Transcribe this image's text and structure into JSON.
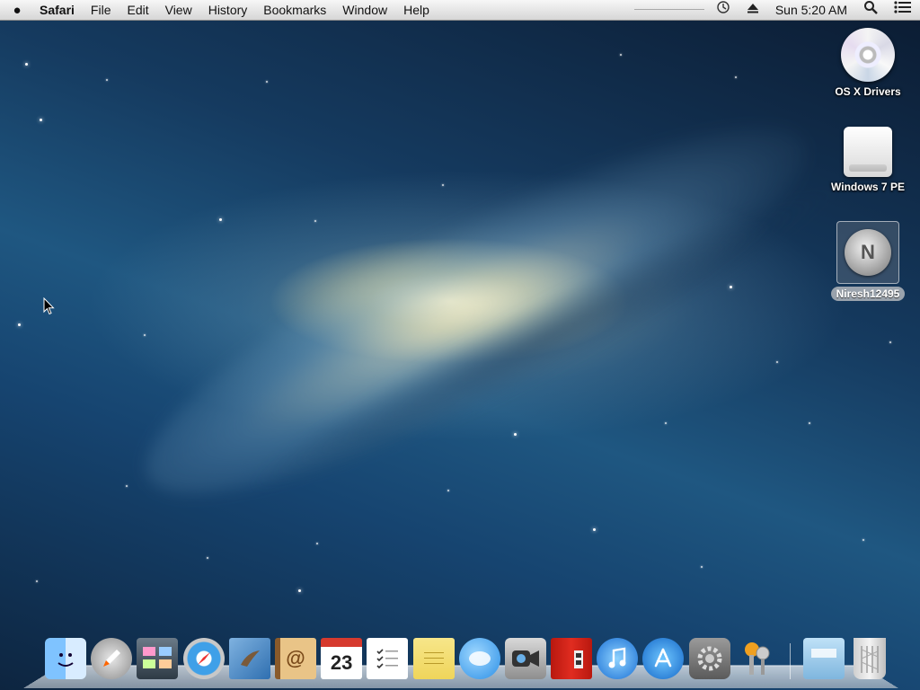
{
  "menubar": {
    "app_name": "Safari",
    "menus": [
      "File",
      "Edit",
      "View",
      "History",
      "Bookmarks",
      "Window",
      "Help"
    ],
    "clock": "Sun 5:20 AM"
  },
  "desktop": {
    "icons": [
      {
        "label": "OS X Drivers"
      },
      {
        "label": "Windows 7 PE"
      },
      {
        "label": "Niresh12495",
        "volume_glyph": "N"
      }
    ]
  },
  "dock": {
    "calendar_day": "23",
    "items": [
      "finder-icon",
      "launchpad-icon",
      "mission-control-icon",
      "safari-icon",
      "mail-icon",
      "contacts-icon",
      "calendar-icon",
      "reminders-icon",
      "notes-icon",
      "messages-icon",
      "facetime-icon",
      "photo-booth-icon",
      "itunes-icon",
      "app-store-icon",
      "system-preferences-icon",
      "keychain-access-icon",
      "documents-folder-icon",
      "trash-icon"
    ]
  }
}
